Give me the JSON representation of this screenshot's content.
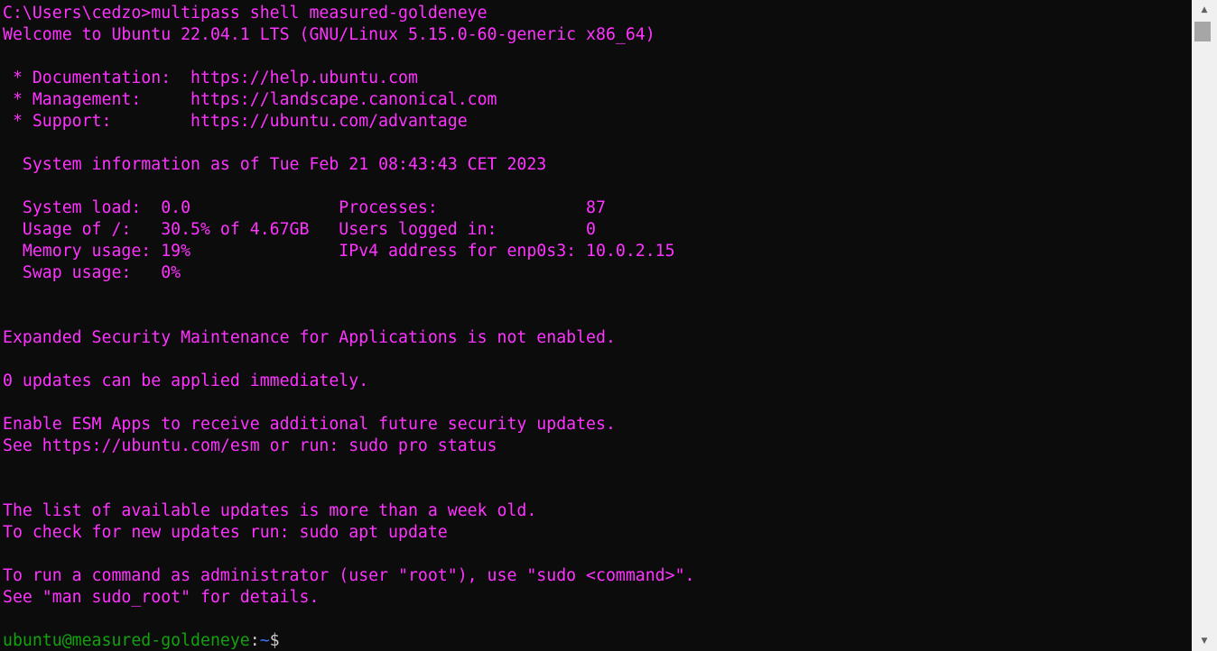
{
  "terminal": {
    "lines": [
      [
        {
          "t": "C:\\Users\\cedzo>multipass shell measured-goldeneye",
          "c": "magenta"
        }
      ],
      [
        {
          "t": "Welcome to Ubuntu 22.04.1 LTS (GNU/Linux 5.15.0-60-generic x86_64)",
          "c": "magenta"
        }
      ],
      [
        {
          "t": "",
          "c": "magenta"
        }
      ],
      [
        {
          "t": " * Documentation:  https://help.ubuntu.com",
          "c": "magenta"
        }
      ],
      [
        {
          "t": " * Management:     https://landscape.canonical.com",
          "c": "magenta"
        }
      ],
      [
        {
          "t": " * Support:        https://ubuntu.com/advantage",
          "c": "magenta"
        }
      ],
      [
        {
          "t": "",
          "c": "magenta"
        }
      ],
      [
        {
          "t": "  System information as of Tue Feb 21 08:43:43 CET 2023",
          "c": "magenta"
        }
      ],
      [
        {
          "t": "",
          "c": "magenta"
        }
      ],
      [
        {
          "t": "  System load:  0.0               Processes:               87",
          "c": "magenta"
        }
      ],
      [
        {
          "t": "  Usage of /:   30.5% of 4.67GB   Users logged in:         0",
          "c": "magenta"
        }
      ],
      [
        {
          "t": "  Memory usage: 19%               IPv4 address for enp0s3: 10.0.2.15",
          "c": "magenta"
        }
      ],
      [
        {
          "t": "  Swap usage:   0%",
          "c": "magenta"
        }
      ],
      [
        {
          "t": "",
          "c": "magenta"
        }
      ],
      [
        {
          "t": "",
          "c": "magenta"
        }
      ],
      [
        {
          "t": "Expanded Security Maintenance for Applications is not enabled.",
          "c": "magenta"
        }
      ],
      [
        {
          "t": "",
          "c": "magenta"
        }
      ],
      [
        {
          "t": "0 updates can be applied immediately.",
          "c": "magenta"
        }
      ],
      [
        {
          "t": "",
          "c": "magenta"
        }
      ],
      [
        {
          "t": "Enable ESM Apps to receive additional future security updates.",
          "c": "magenta"
        }
      ],
      [
        {
          "t": "See https://ubuntu.com/esm or run: sudo pro status",
          "c": "magenta"
        }
      ],
      [
        {
          "t": "",
          "c": "magenta"
        }
      ],
      [
        {
          "t": "",
          "c": "magenta"
        }
      ],
      [
        {
          "t": "The list of available updates is more than a week old.",
          "c": "magenta"
        }
      ],
      [
        {
          "t": "To check for new updates run: sudo apt update",
          "c": "magenta"
        }
      ],
      [
        {
          "t": "",
          "c": "magenta"
        }
      ],
      [
        {
          "t": "To run a command as administrator (user \"root\"), use \"sudo <command>\".",
          "c": "magenta"
        }
      ],
      [
        {
          "t": "See \"man sudo_root\" for details.",
          "c": "magenta"
        }
      ],
      [
        {
          "t": "",
          "c": "magenta"
        }
      ],
      [
        {
          "t": "ubuntu@measured-goldeneye",
          "c": "green"
        },
        {
          "t": ":",
          "c": "prompt"
        },
        {
          "t": "~",
          "c": "blue"
        },
        {
          "t": "$",
          "c": "prompt"
        }
      ]
    ]
  },
  "scrollbar": {
    "up_icon": "triangle-up-icon",
    "down_icon": "triangle-down-icon"
  },
  "colors": {
    "background": "#0c0c0c",
    "magenta": "#ff33ff",
    "green": "#13a10e",
    "blue": "#3b78ff",
    "prompt": "#cccccc",
    "scrollbar_track": "#f0f0f0",
    "scrollbar_thumb": "#a6a6a6"
  }
}
